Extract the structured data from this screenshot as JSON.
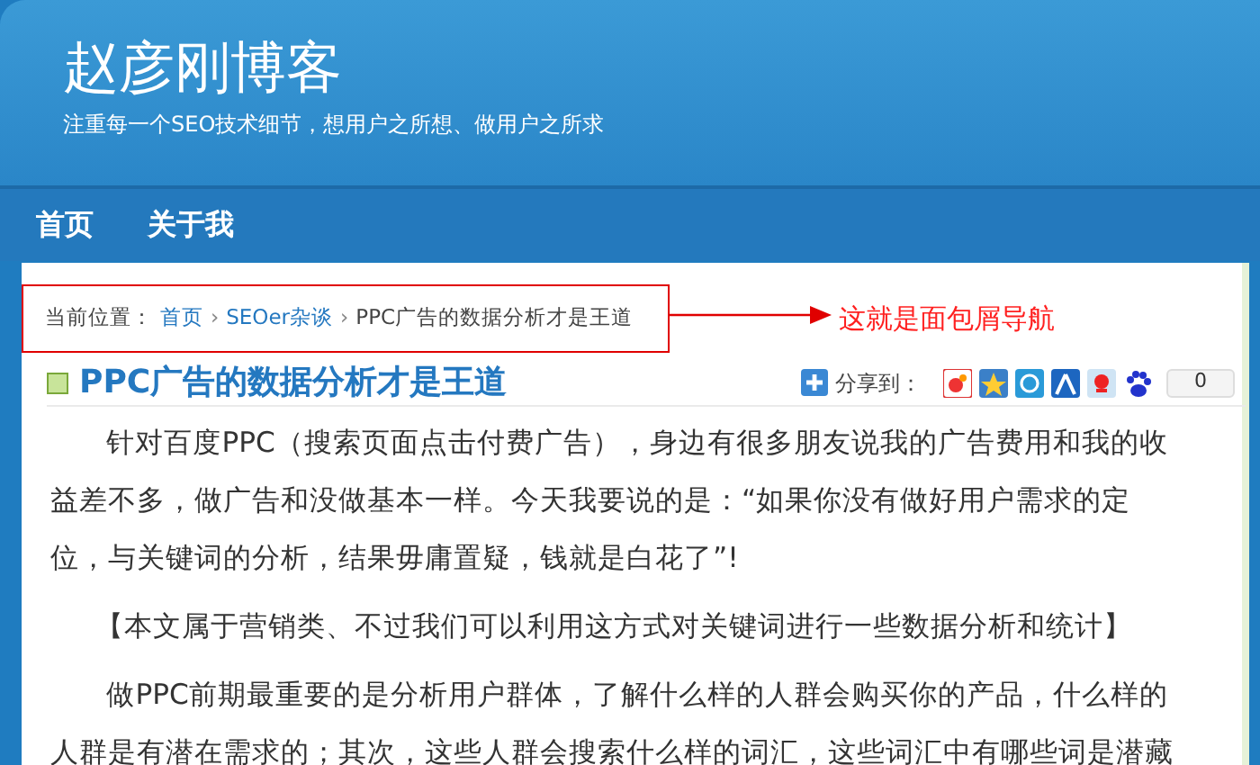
{
  "site": {
    "title": "赵彦刚博客",
    "tagline": "注重每一个SEO技术细节，想用户之所想、做用户之所求"
  },
  "nav": [
    {
      "label": "首页"
    },
    {
      "label": "关于我"
    }
  ],
  "breadcrumb": {
    "prefix": "当前位置：",
    "links": [
      "首页",
      "SEOer杂谈"
    ],
    "current": "PPC广告的数据分析才是王道",
    "separator": "›"
  },
  "annotation": {
    "text": "这就是面包屑导航"
  },
  "post": {
    "title": "PPC广告的数据分析才是王道",
    "share_label": "分享到：",
    "share_count": "0",
    "paragraphs": [
      {
        "kind": "indent",
        "text": "针对百度PPC（搜索页面点击付费广告），身边有很多朋友说我的广告费用和我的收益差不多，做广告和没做基本一样。今天我要说的是：“如果你没有做好用户需求的定位，与关键词的分析，结果毋庸置疑，钱就是白花了”!"
      },
      {
        "kind": "center",
        "text": "【本文属于营销类、不过我们可以利用这方式对关键词进行一些数据分析和统计】"
      },
      {
        "kind": "indent",
        "text": "做PPC前期最重要的是分析用户群体，了解什么样的人群会购买你的产品，什么样的人群是有潜在需求的；其次，这些人群会搜索什么样的词汇，这些词汇中有哪些词是潜藏"
      }
    ]
  }
}
